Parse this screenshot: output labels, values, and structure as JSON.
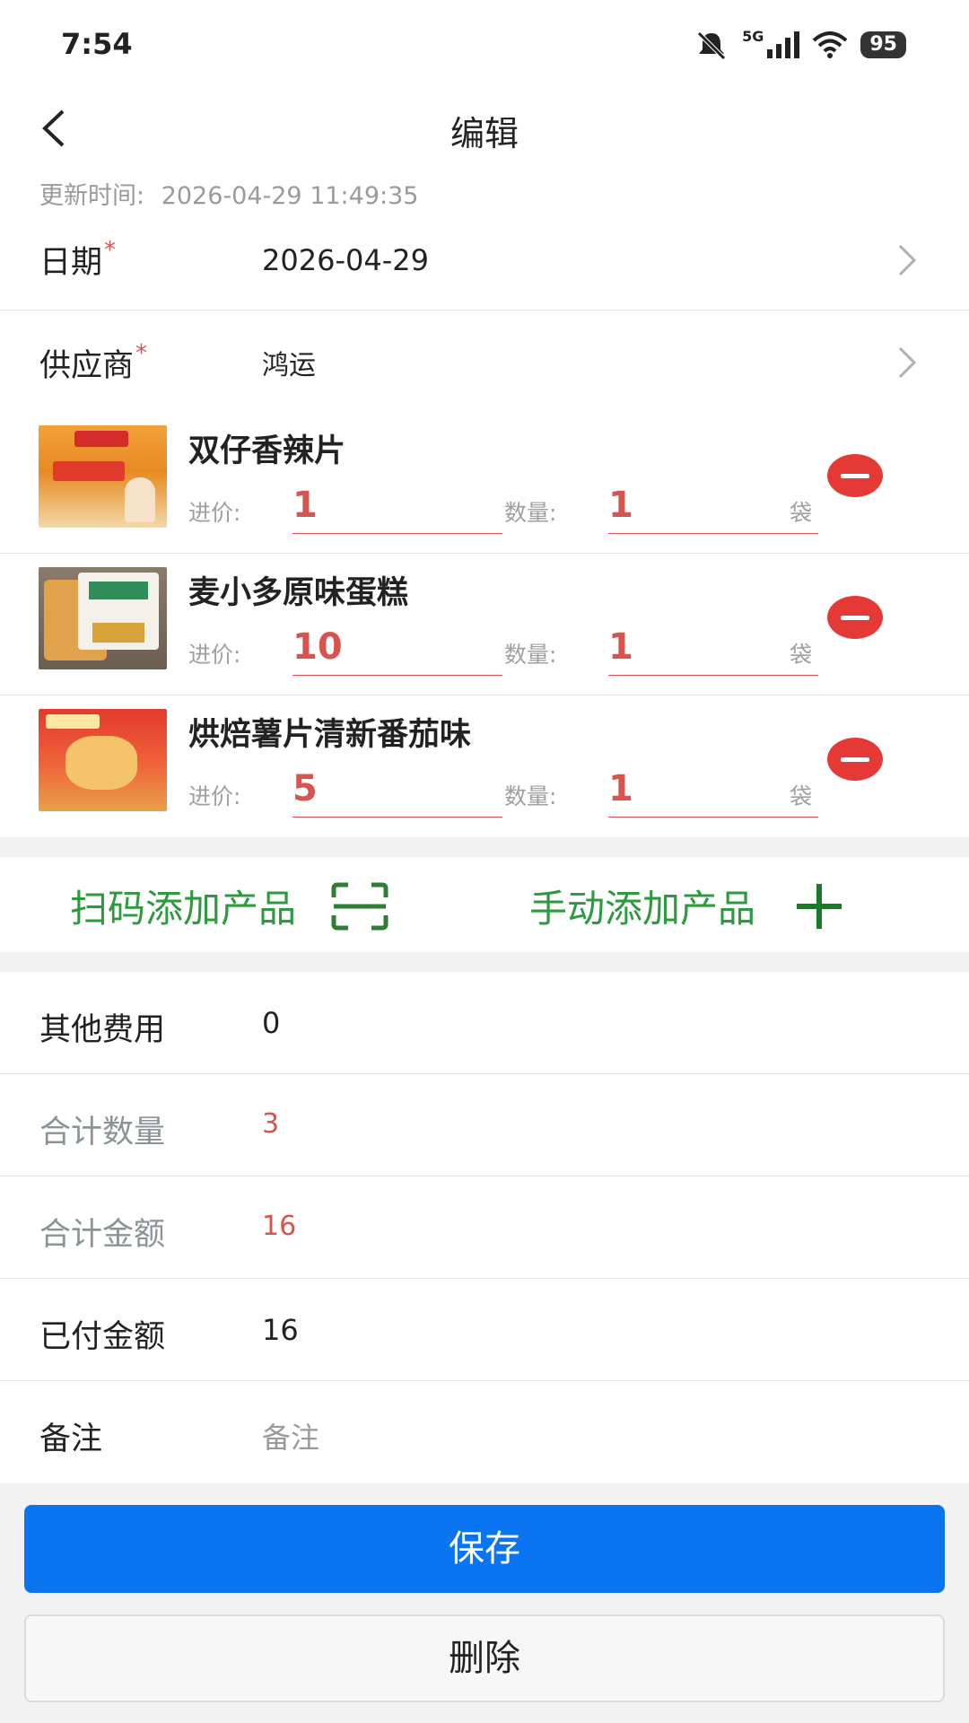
{
  "status_bar": {
    "time": "7:54",
    "network": "5G",
    "battery": "95"
  },
  "header": {
    "title": "编辑"
  },
  "update": {
    "label": "更新时间:",
    "value": "2026-04-29 11:49:35"
  },
  "form": {
    "date": {
      "label": "日期",
      "required": "*",
      "value": "2026-04-29"
    },
    "supplier": {
      "label": "供应商",
      "required": "*",
      "value": "鸿运"
    }
  },
  "products": [
    {
      "name": "双仔香辣片",
      "price_label": "进价:",
      "price": "1",
      "qty_label": "数量:",
      "qty": "1",
      "unit": "袋"
    },
    {
      "name": "麦小多原味蛋糕",
      "price_label": "进价:",
      "price": "10",
      "qty_label": "数量:",
      "qty": "1",
      "unit": "袋"
    },
    {
      "name": "烘焙薯片清新番茄味",
      "price_label": "进价:",
      "price": "5",
      "qty_label": "数量:",
      "qty": "1",
      "unit": "袋"
    }
  ],
  "actions": {
    "scan_add": "扫码添加产品",
    "manual_add": "手动添加产品"
  },
  "summary": {
    "other_fee": {
      "label": "其他费用",
      "value": "0"
    },
    "total_qty": {
      "label": "合计数量",
      "value": "3"
    },
    "total_amount": {
      "label": "合计金额",
      "value": "16"
    },
    "paid_amount": {
      "label": "已付金额",
      "value": "16"
    },
    "remark": {
      "label": "备注",
      "placeholder": "备注"
    }
  },
  "buttons": {
    "save": "保存",
    "delete": "删除"
  },
  "colors": {
    "accent_green": "#2e9a3e",
    "red": "#d9534f",
    "primary_blue": "#0b74f0"
  }
}
